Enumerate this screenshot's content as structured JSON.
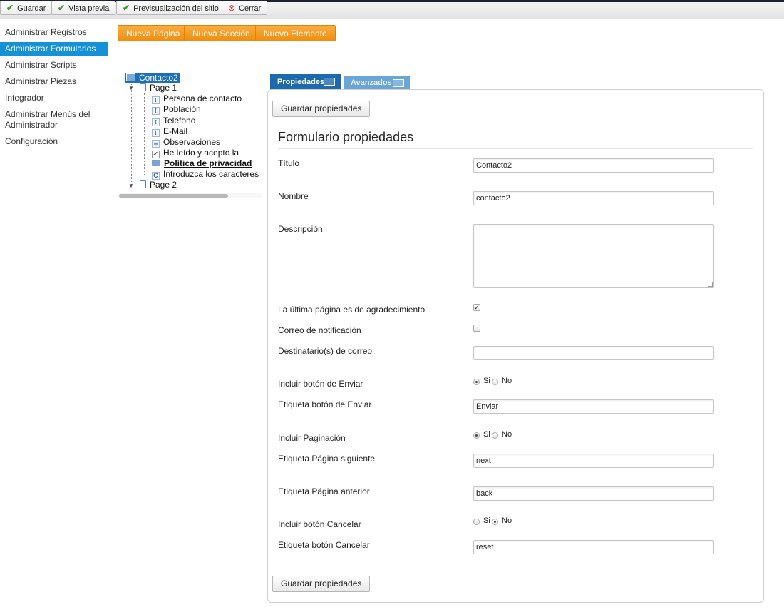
{
  "toolbar": {
    "buttons": [
      {
        "label": "Guardar",
        "icon": "check-icon"
      },
      {
        "label": "Vista previa",
        "icon": "check-icon"
      },
      {
        "label": "Previsualización del sitio",
        "icon": "check-icon"
      },
      {
        "label": "Cerrar",
        "icon": "close-icon"
      }
    ]
  },
  "sidebar": {
    "items": [
      {
        "label": "Administrar Registros",
        "active": false
      },
      {
        "label": "Administrar Formularios",
        "active": true
      },
      {
        "label": "Administrar Scripts",
        "active": false
      },
      {
        "label": "Administrar Piezas",
        "active": false
      },
      {
        "label": "Integrador",
        "active": false
      },
      {
        "label": "Administrar Menús del Administrador",
        "active": false
      },
      {
        "label": "Configuración",
        "active": false
      }
    ]
  },
  "actions": {
    "new_page": "Nueva Página",
    "new_section": "Nueva Sección",
    "new_element": "Nuevo Elemento"
  },
  "tree": {
    "root": "Contacto2",
    "page1": "Page 1",
    "fields": [
      {
        "label": "Persona de contacto",
        "icon": "text-field-icon"
      },
      {
        "label": "Población",
        "icon": "text-field-icon"
      },
      {
        "label": "Teléfono",
        "icon": "text-field-icon"
      },
      {
        "label": "E-Mail",
        "icon": "text-field-icon"
      },
      {
        "label": "Observaciones",
        "icon": "textarea-field-icon"
      },
      {
        "label": "He leído y acepto la",
        "icon": "checkbox-field-icon"
      },
      {
        "label": "Política de privacidad",
        "icon": "folder-icon"
      },
      {
        "label": "Introduzca los caracteres de",
        "icon": "captcha-field-icon"
      }
    ],
    "page2": "Page 2"
  },
  "tabs": {
    "properties": "Propiedades",
    "advanced": "Avanzados"
  },
  "form": {
    "save_label": "Guardar propiedades",
    "heading": "Formulario propiedades",
    "title_label": "Título",
    "title_value": "Contacto2",
    "name_label": "Nombre",
    "name_value": "contacto2",
    "description_label": "Descripción",
    "description_value": "",
    "thankyou_label": "La última página es de agradecimiento",
    "thankyou_checked": true,
    "notify_label": "Correo de notificación",
    "notify_checked": false,
    "recipients_label": "Destinatario(s) de correo",
    "recipients_value": "",
    "submit_label": "Incluir botón de Enviar",
    "submit_choice": "Si",
    "submit_text_label": "Etiqueta botón de Enviar",
    "submit_text_value": "Enviar",
    "paging_label": "Incluir Paginación",
    "paging_choice": "Si",
    "next_label": "Etiqueta Página siguiente",
    "next_value": "next",
    "prev_label": "Etiqueta Página anterior",
    "prev_value": "back",
    "cancel_label": "Incluir botón Cancelar",
    "cancel_choice": "No",
    "cancel_text_label": "Etiqueta botón Cancelar",
    "cancel_text_value": "reset",
    "yes": "Si",
    "no": "No"
  },
  "colors": {
    "accent": "#1591d8",
    "orange": "#f39a1c",
    "tab_active": "#1c6aae",
    "tab_inactive": "#6aa5d8"
  }
}
